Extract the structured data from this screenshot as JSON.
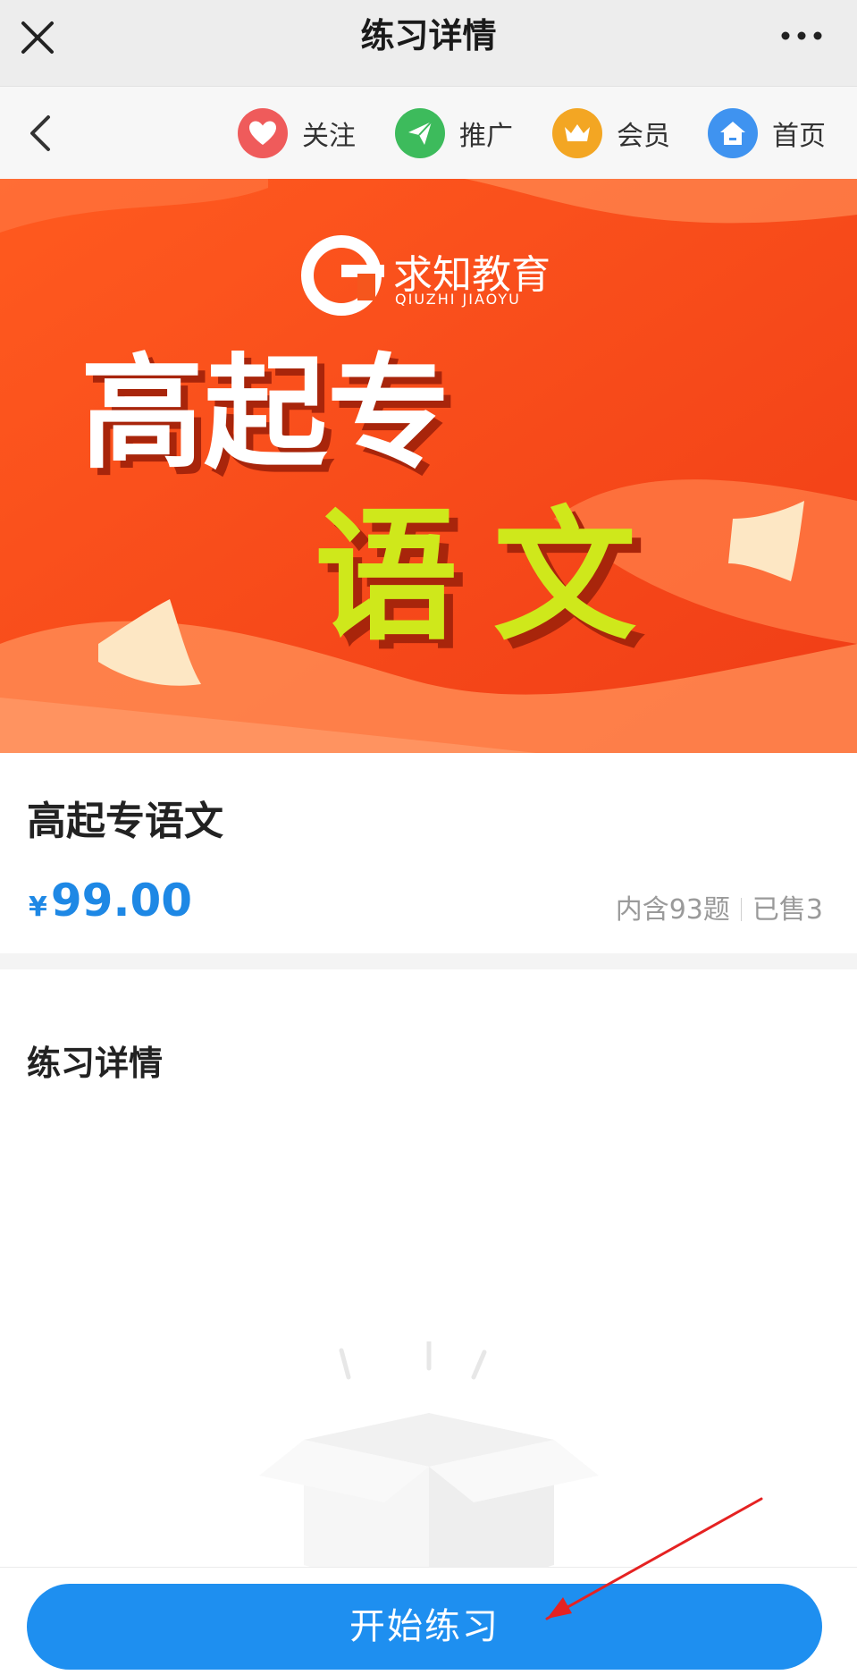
{
  "titlebar": {
    "title": "练习详情"
  },
  "nav": {
    "items": [
      {
        "label": "关注",
        "icon": "heart-icon",
        "color": "#ef5b5b"
      },
      {
        "label": "推广",
        "icon": "paper-plane-icon",
        "color": "#3dbb5c"
      },
      {
        "label": "会员",
        "icon": "crown-icon",
        "color": "#f3a623"
      },
      {
        "label": "首页",
        "icon": "home-icon",
        "color": "#3f93f0"
      }
    ]
  },
  "banner": {
    "brand_cn": "求知教育",
    "brand_en": "QIUZHI JIAOYU",
    "line1": "高起专",
    "line2": "语文"
  },
  "product": {
    "name": "高起专语文",
    "currency": "¥",
    "price": "99.00",
    "questions": "内含93题",
    "sold": "已售3"
  },
  "detail": {
    "title": "练习详情"
  },
  "action": {
    "start_label": "开始练习"
  },
  "colors": {
    "accent": "#1e8ff0",
    "banner": "#f04b1c",
    "highlight": "#cfe81b"
  }
}
